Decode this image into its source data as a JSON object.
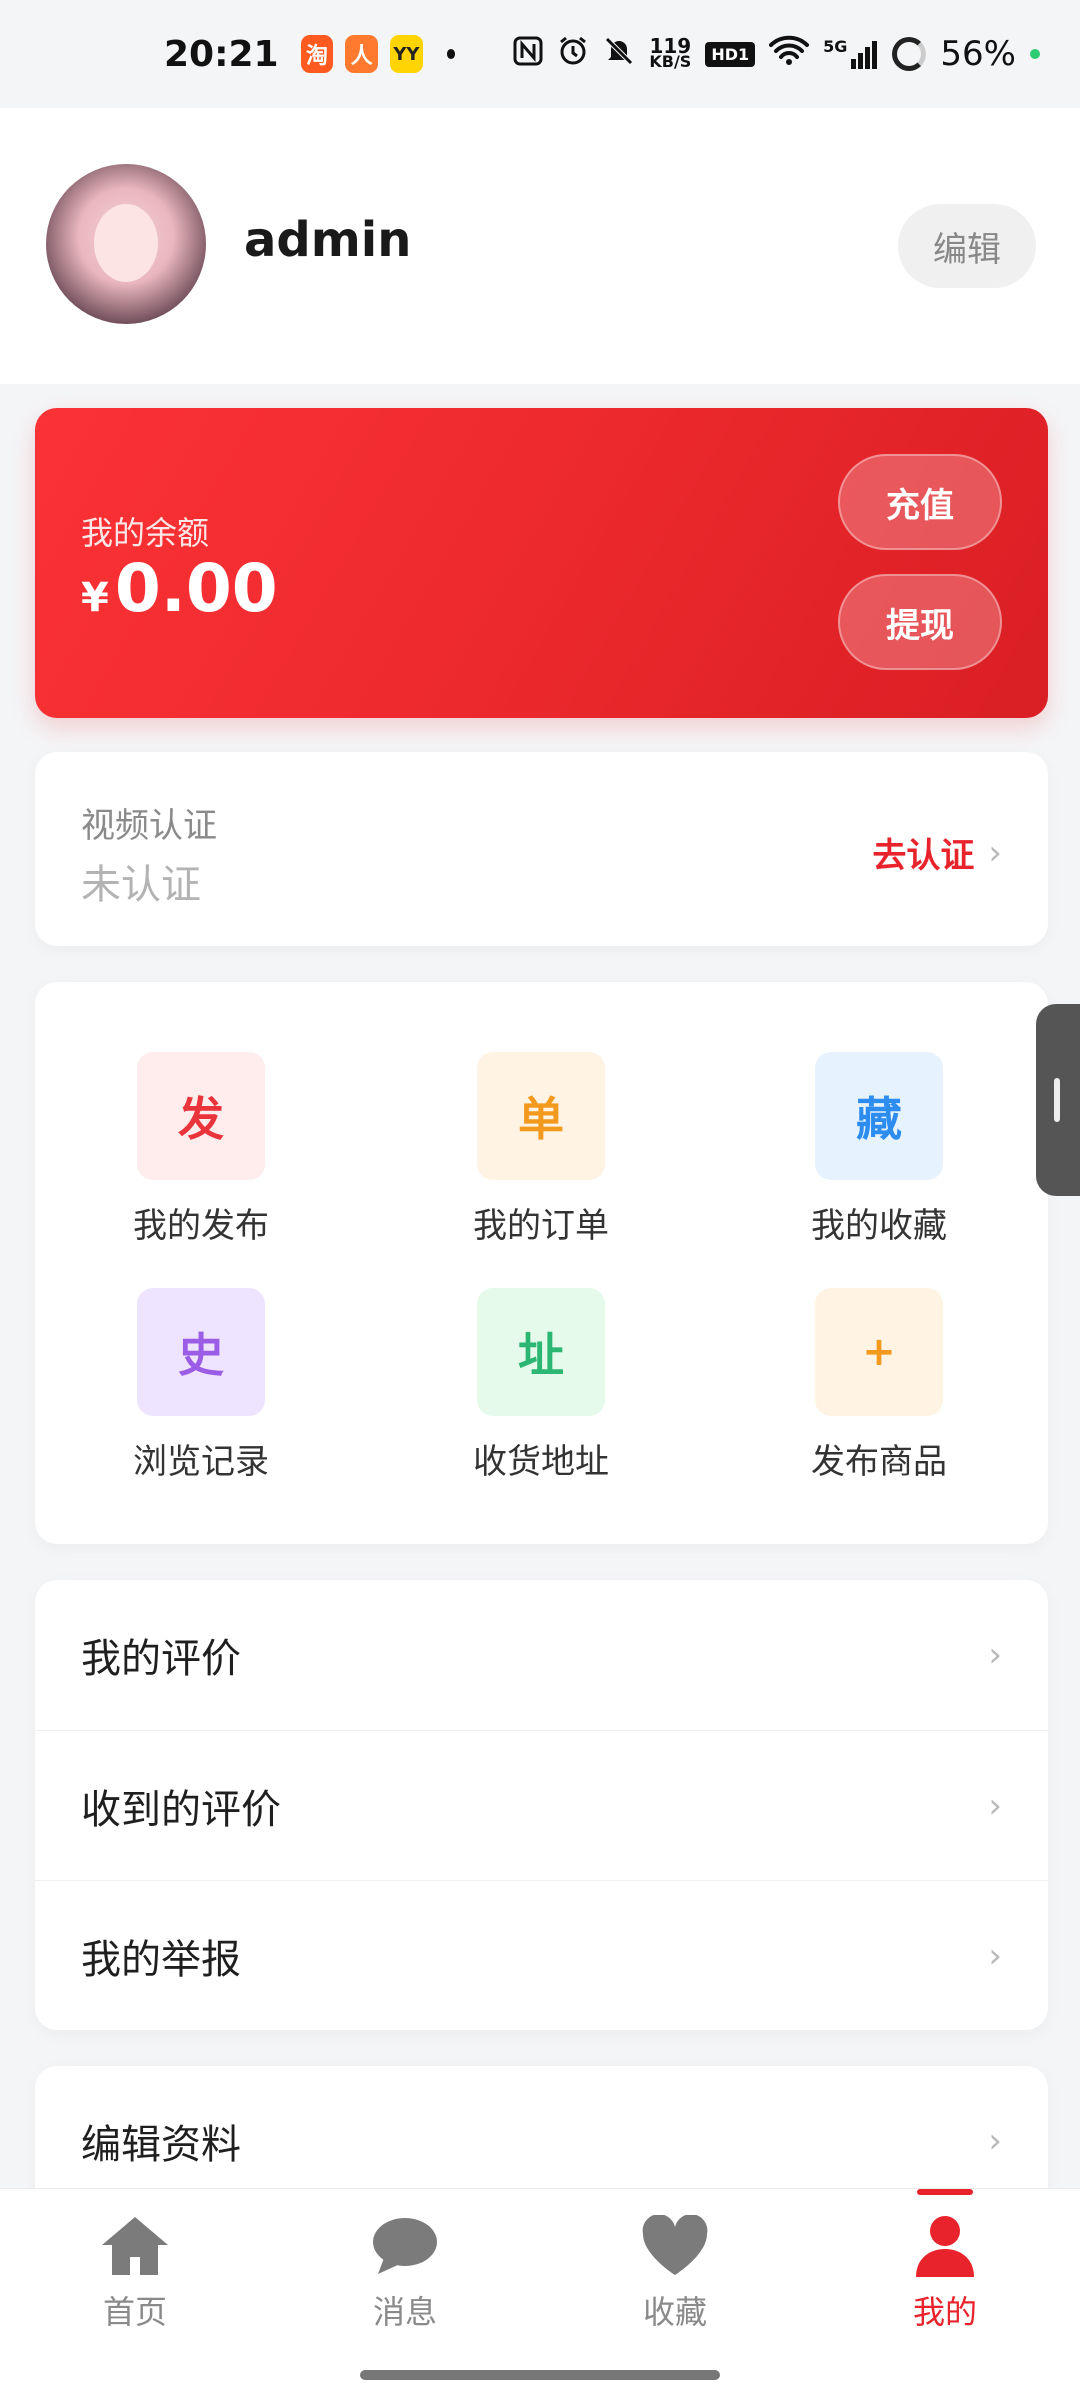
{
  "status_bar": {
    "time": "20:21",
    "apps": [
      {
        "name": "taobao-app-icon",
        "glyph": "淘",
        "color": "#ff5a1f"
      },
      {
        "name": "alipay-app-icon",
        "glyph": "人",
        "color": "#ff7a2f"
      },
      {
        "name": "yy-app-icon",
        "glyph": "YY",
        "color": "#ffd400"
      }
    ],
    "speed_top": "119",
    "speed_bottom": "KB/S",
    "hd": "HD1",
    "network": "5G",
    "battery": "56%"
  },
  "profile": {
    "username": "admin",
    "edit_label": "编辑"
  },
  "balance": {
    "label": "我的余额",
    "currency": "¥",
    "amount": "0.00",
    "recharge_label": "充值",
    "withdraw_label": "提现",
    "accent": "#f0282d"
  },
  "verification": {
    "label": "视频认证",
    "status": "未认证",
    "action_label": "去认证",
    "chevron": "›"
  },
  "grid": {
    "items": [
      {
        "glyph": "发",
        "label": "我的发布",
        "fg": "#e8343a",
        "bg": "#ffecec"
      },
      {
        "glyph": "单",
        "label": "我的订单",
        "fg": "#f39a1e",
        "bg": "#fff3e3"
      },
      {
        "glyph": "藏",
        "label": "我的收藏",
        "fg": "#2d8cf0",
        "bg": "#e6f3ff"
      },
      {
        "glyph": "史",
        "label": "浏览记录",
        "fg": "#9b5de5",
        "bg": "#efe4ff"
      },
      {
        "glyph": "址",
        "label": "收货地址",
        "fg": "#2bb673",
        "bg": "#e5faea"
      },
      {
        "glyph": "+",
        "label": "发布商品",
        "fg": "#f39a1e",
        "bg": "#fff3e3"
      }
    ]
  },
  "menu": {
    "items": [
      {
        "label": "我的评价"
      },
      {
        "label": "收到的评价"
      },
      {
        "label": "我的举报"
      }
    ],
    "chevron": "›"
  },
  "menu2": {
    "items": [
      {
        "label": "编辑资料"
      }
    ]
  },
  "tabbar": {
    "tabs": [
      {
        "label": "首页",
        "icon": "home-icon"
      },
      {
        "label": "消息",
        "icon": "chat-bubble-icon"
      },
      {
        "label": "收藏",
        "icon": "heart-icon"
      },
      {
        "label": "我的",
        "icon": "person-icon",
        "active": true
      }
    ],
    "active_color": "#e8232c",
    "inactive_color": "#8a8a8a"
  }
}
